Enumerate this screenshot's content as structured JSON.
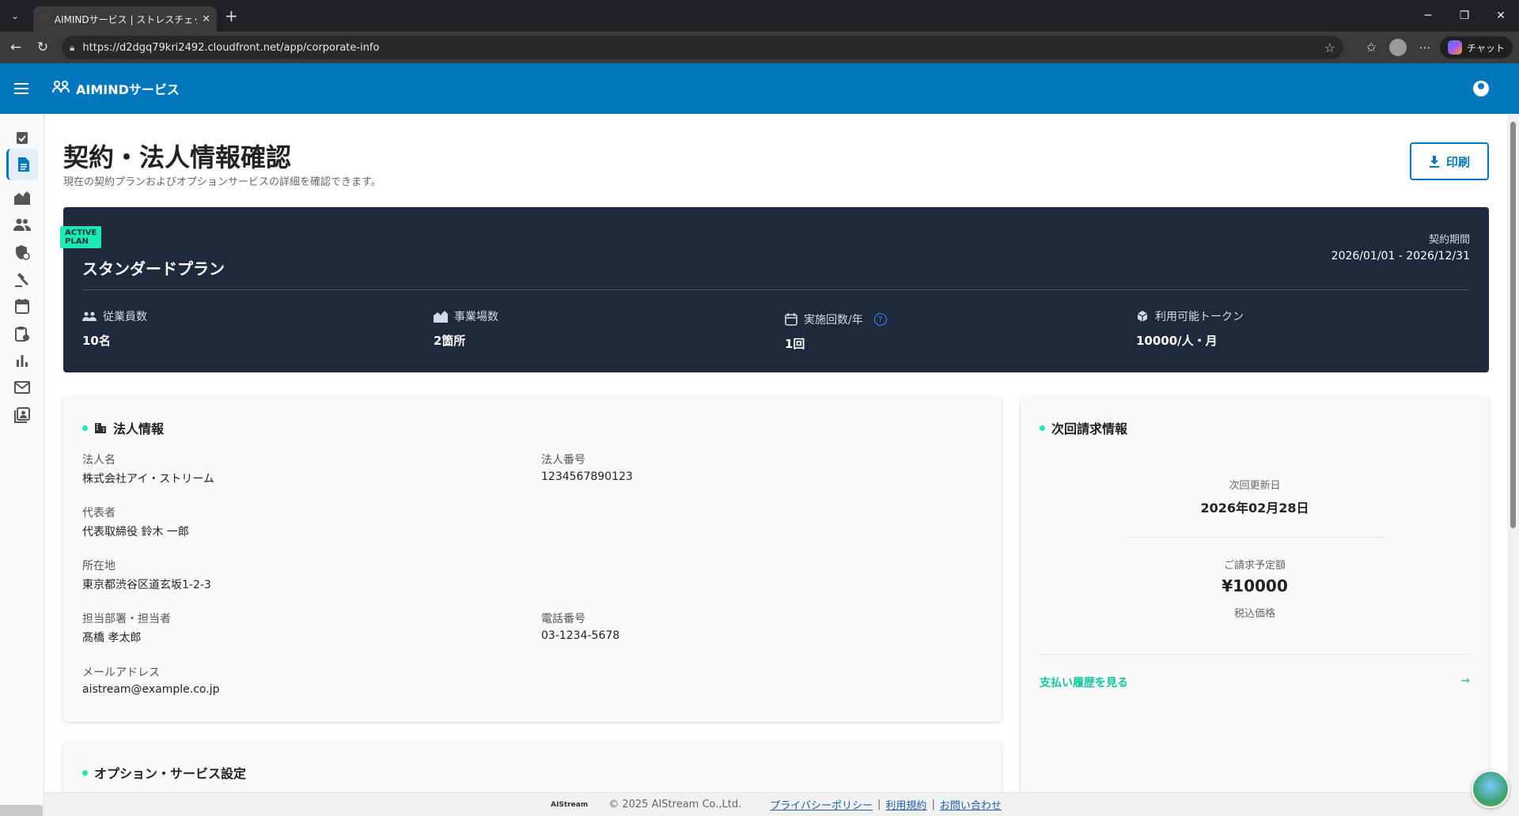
{
  "browser": {
    "tab_title": "AIMINDサービス | ストレスチェック×デジ",
    "url": "https://d2dgq79kri2492.cloudfront.net/app/corporate-info",
    "chat_label": "チャット"
  },
  "header": {
    "brand": "AIMINDサービス"
  },
  "sidebar": {
    "items": [
      {
        "icon": "checklist-icon"
      },
      {
        "icon": "document-icon",
        "active": true
      },
      {
        "icon": "buildings-icon"
      },
      {
        "icon": "people-icon"
      },
      {
        "icon": "shield-icon"
      },
      {
        "icon": "gavel-icon"
      },
      {
        "icon": "calendar-icon"
      },
      {
        "icon": "clipboard-icon"
      },
      {
        "icon": "bar-chart-icon"
      },
      {
        "icon": "mail-icon"
      },
      {
        "icon": "contacts-icon"
      }
    ]
  },
  "page": {
    "title": "契約・法人情報確認",
    "subtitle": "現在の契約プランおよびオプションサービスの詳細を確認できます。",
    "print_label": "印刷"
  },
  "plan": {
    "badge_line1": "ACTIVE",
    "badge_line2": "PLAN",
    "name": "スタンダードプラン",
    "period_label": "契約期間",
    "period_value": "2026/01/01 - 2026/12/31",
    "stats": [
      {
        "label": "従業員数",
        "value": "10名"
      },
      {
        "label": "事業場数",
        "value": "2箇所"
      },
      {
        "label": "実施回数/年",
        "value": "1回"
      },
      {
        "label": "利用可能トークン",
        "value": "10000/人・月"
      }
    ]
  },
  "corporate": {
    "title": "法人情報",
    "name_label": "法人名",
    "name_value": "株式会社アイ・ストリーム",
    "number_label": "法人番号",
    "number_value": "1234567890123",
    "rep_label": "代表者",
    "rep_value": "代表取締役 鈴木 一郎",
    "address_label": "所在地",
    "address_value": "東京都渋谷区道玄坂1-2-3",
    "contact_label": "担当部署・担当者",
    "contact_value": "髙橋 孝太郎",
    "phone_label": "電話番号",
    "phone_value": "03-1234-5678",
    "email_label": "メールアドレス",
    "email_value": "aistream@example.co.jp"
  },
  "billing": {
    "title": "次回請求情報",
    "renew_label": "次回更新日",
    "renew_value": "2026年02月28日",
    "amount_label": "ご請求予定額",
    "amount_value": "¥10000",
    "tax_note": "税込価格",
    "history_link": "支払い履歴を見る"
  },
  "options": {
    "title": "オプション・サービス設定"
  },
  "footer": {
    "logo": "AIStream",
    "copyright": "© 2025 AIStream Co.,Ltd.",
    "privacy": "プライバシーポリシー",
    "terms": "利用規約",
    "contact": "お問い合わせ",
    "separator": "|"
  }
}
